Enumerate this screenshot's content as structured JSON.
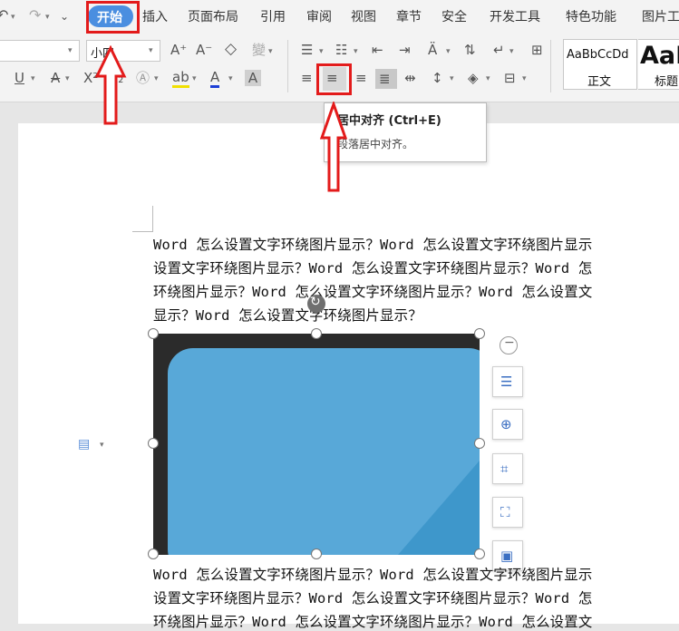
{
  "quick_access": {
    "undo_icon": "undo-icon",
    "redo_icon": "redo-icon",
    "customize_icon": "chevron-down-icon"
  },
  "menu": {
    "items": [
      {
        "label": "开始",
        "active": true
      },
      {
        "label": "插入"
      },
      {
        "label": "页面布局"
      },
      {
        "label": "引用"
      },
      {
        "label": "审阅"
      },
      {
        "label": "视图"
      },
      {
        "label": "章节"
      },
      {
        "label": "安全"
      },
      {
        "label": "开发工具"
      },
      {
        "label": "特色功能"
      },
      {
        "label": "图片工"
      }
    ],
    "active_color": "#4a8ee0"
  },
  "ribbon": {
    "font_size_value": "小四",
    "styles": [
      {
        "preview": "AaBbCcDd",
        "name": "正文"
      },
      {
        "preview": "AaI",
        "name": "标题"
      }
    ]
  },
  "tooltip": {
    "title": "居中对齐 (Ctrl+E)",
    "description": "段落居中对齐。"
  },
  "document": {
    "para1": [
      "Word 怎么设置文字环绕图片显示？Word 怎么设置文字环绕图片显示",
      "设置文字环绕图片显示？Word 怎么设置文字环绕图片显示？Word 怎",
      "环绕图片显示？Word 怎么设置文字环绕图片显示？Word 怎么设置文",
      "显示？Word 怎么设置文字环绕图片显示？"
    ],
    "para2": [
      "Word 怎么设置文字环绕图片显示？Word 怎么设置文字环绕图片显示",
      "设置文字环绕图片显示？Word 怎么设置文字环绕图片显示？Word 怎",
      "环绕图片显示？Word 怎么设置文字环绕图片显示？Word 怎么设置文"
    ]
  },
  "annotation_color": "#e31b1b"
}
